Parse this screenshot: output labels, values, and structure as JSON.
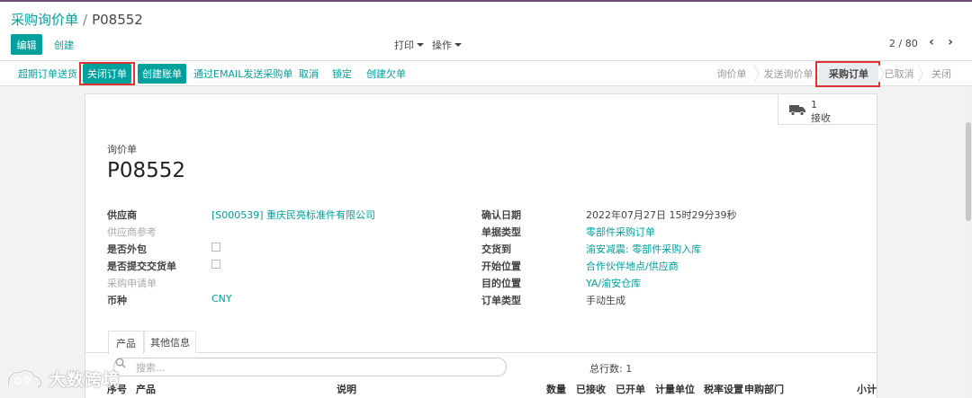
{
  "breadcrumb": {
    "parent": "采购询价单",
    "separator": "/",
    "current": "P08552"
  },
  "control": {
    "edit_label": "编辑",
    "create_label": "创建",
    "print_label": "打印",
    "action_label": "操作",
    "pager": "2 / 80",
    "prev_icon": "‹",
    "next_icon": "›"
  },
  "header_buttons": [
    "超期订单送货",
    "关闭订单",
    "创建账单",
    "通过EMAIL发送采购单",
    "取消",
    "锁定",
    "创建欠单"
  ],
  "status_stages": [
    "询价单",
    "发送询价单",
    "采购订单",
    "已取消",
    "关闭"
  ],
  "status_active": "采购订单",
  "smart_button": {
    "count": "1",
    "label": "接收",
    "icon": "truck-icon"
  },
  "record": {
    "type_label": "询价单",
    "name": "P08552"
  },
  "left_fields": [
    {
      "label": "供应商",
      "value": "[S000539] 重庆民亮标准件有限公司",
      "kind": "link"
    },
    {
      "label": "供应商参考",
      "value": "",
      "kind": "muted"
    },
    {
      "label": "是否外包",
      "value": "",
      "kind": "checkbox"
    },
    {
      "label": "是否提交交货单",
      "value": "",
      "kind": "checkbox"
    },
    {
      "label": "采购申请单",
      "value": "",
      "kind": "muted"
    },
    {
      "label": "币种",
      "value": "CNY",
      "kind": "link"
    }
  ],
  "right_fields": [
    {
      "label": "确认日期",
      "value": "2022年07月27日 15时29分39秒",
      "kind": "text"
    },
    {
      "label": "单据类型",
      "value": "零部件采购订单",
      "kind": "link"
    },
    {
      "label": "交货到",
      "value": "渝安减震: 零部件采购入库",
      "kind": "link"
    },
    {
      "label": "开始位置",
      "value": "合作伙伴地点/供应商",
      "kind": "link"
    },
    {
      "label": "目的位置",
      "value": "YA/渝安仓库",
      "kind": "link"
    },
    {
      "label": "订单类型",
      "value": "手动生成",
      "kind": "text"
    }
  ],
  "tabs": [
    "产品",
    "其他信息"
  ],
  "search": {
    "placeholder": "搜索..."
  },
  "total_rows": "总行数: 1",
  "table_headers": [
    "序号",
    "产品",
    "说明",
    "数量",
    "已接收",
    "已开单",
    "计量单位",
    "税率设置",
    "申购部门",
    "小计"
  ],
  "watermark": {
    "text": "大数跨境"
  },
  "colors": {
    "accent": "#00a09d",
    "highlight": "#e03131",
    "topbar": "#6c4c7a"
  }
}
